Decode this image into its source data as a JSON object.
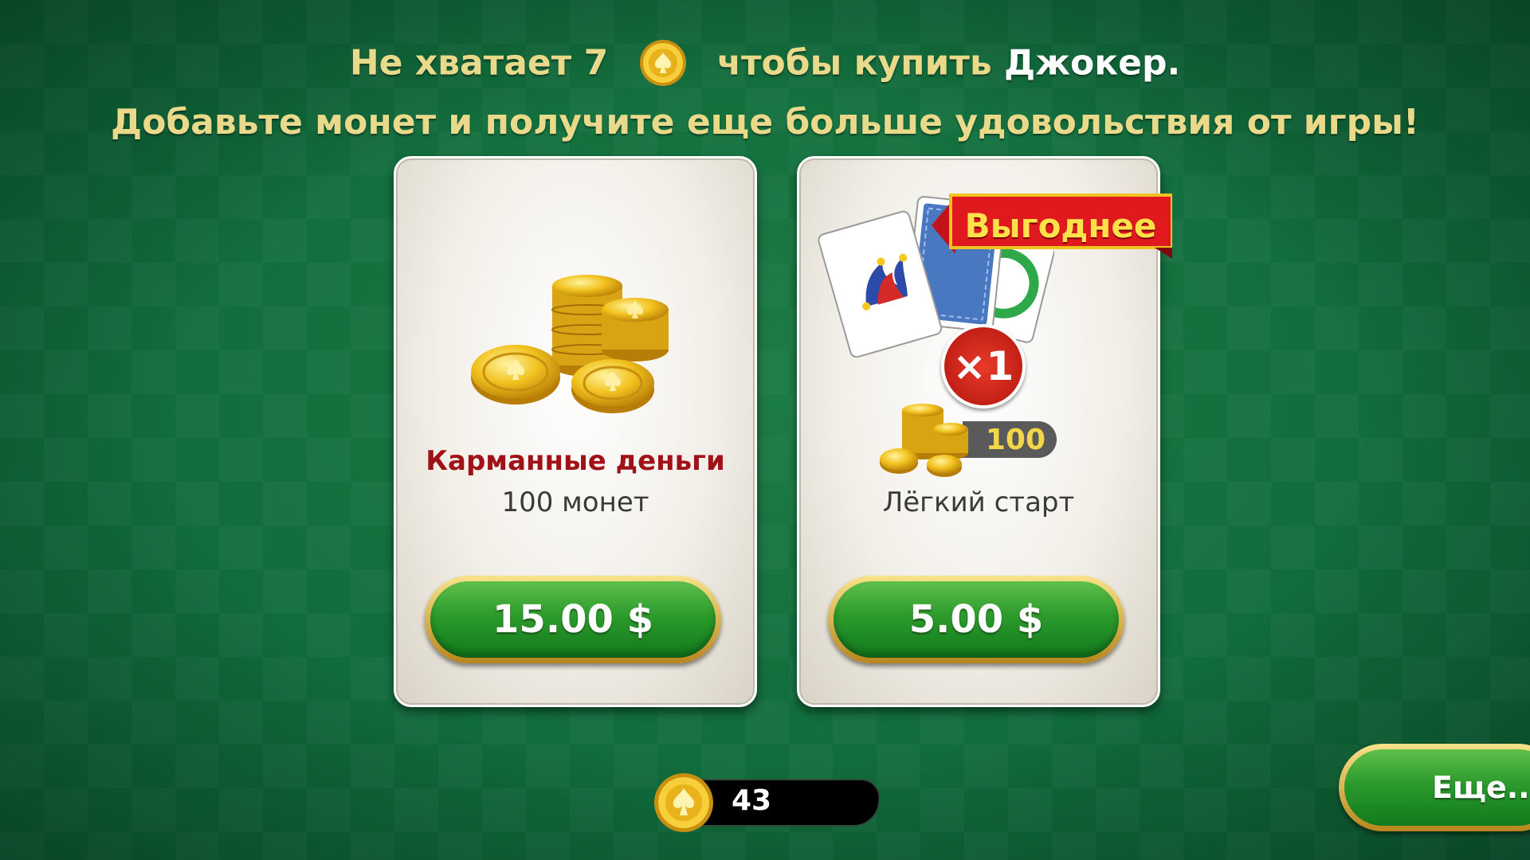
{
  "header": {
    "line1_prefix": "Не хватает 7",
    "line1_middle": "чтобы купить",
    "item_name": "Джокер.",
    "line2": "Добавьте монет и получите еще больше удовольствия от игры!"
  },
  "offers": [
    {
      "title": "Карманные деньги",
      "subtitle": "100 монет",
      "price": "15.00 $"
    },
    {
      "badge": "Выгоднее",
      "multiplier": "×1",
      "coin_count": "100",
      "subtitle": "Лёгкий старт",
      "price": "5.00 $"
    }
  ],
  "balance": {
    "coins": "43"
  },
  "more_button": {
    "label": "Еще..."
  },
  "colors": {
    "felt": "#0f6a3a",
    "gold_text": "#e9d98a",
    "title_red": "#a01218",
    "button_green": "#2c9a2c"
  },
  "icons": [
    "spade-coin-icon",
    "coin-pile-icon",
    "joker-hat-icon",
    "card-back-icon"
  ]
}
